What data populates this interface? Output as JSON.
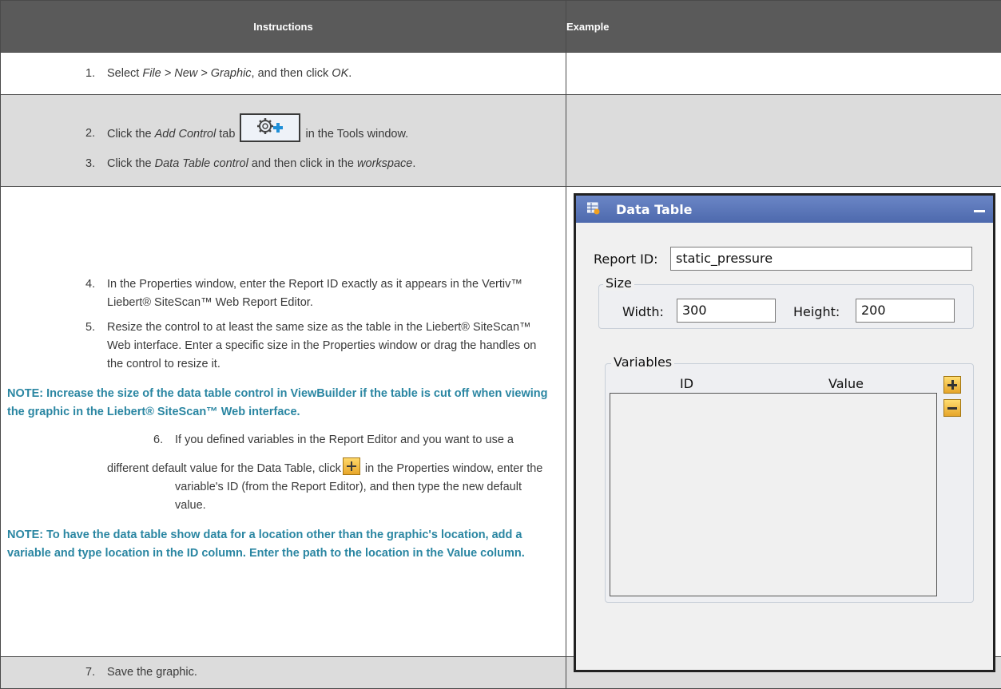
{
  "header": {
    "instructions": "Instructions",
    "example": "Example"
  },
  "row1": {
    "num": "1.",
    "pre": "Select ",
    "path": "File > New > Graphic",
    "mid": ", and then click ",
    "ok": "OK",
    "post": "."
  },
  "row2": {
    "step2_num": "2.",
    "step2_pre": "Click the ",
    "step2_tab": "Add Control",
    "step2_mid": " tab",
    "step2_post": " in the Tools window.",
    "step3_num": "3.",
    "step3_pre": "Click the ",
    "step3_control": "Data Table control",
    "step3_mid": " and then click in the ",
    "step3_ws": "workspace",
    "step3_post": "."
  },
  "row3": {
    "step4_num": "4.",
    "step4_text": "In the Properties window, enter the Report ID exactly as it appears in the Vertiv™ Liebert® SiteScan™ Web Report Editor.",
    "step5_num": "5.",
    "step5_text": "Resize the control to at least the same size as the table in the Liebert® SiteScan™ Web interface. Enter a specific size in the Properties window or drag the handles on the control to resize it.",
    "note1": "NOTE: Increase the size of the data table control in ViewBuilder if the table is cut off when viewing the graphic in the Liebert® SiteScan™ Web interface.",
    "step6_num": "6.",
    "step6_a": "If you defined variables in the Report Editor and you want to use a",
    "step6_b": "different default value for the Data Table, click",
    "step6_c": " in the Properties window, enter the variable's ID (from the Report Editor), and then type the new default value.",
    "note2": "NOTE: To have the data table show data for a location other than the graphic's location, add a variable and type location in the ID column. Enter the path to the location in the Value column."
  },
  "row4": {
    "num": "7.",
    "text": "Save the graphic."
  },
  "panel": {
    "title": "Data Table",
    "report_id_label": "Report ID:",
    "report_id_value": "static_pressure",
    "size_legend": "Size",
    "width_label": "Width:",
    "width_value": "300",
    "height_label": "Height:",
    "height_value": "200",
    "variables_legend": "Variables",
    "col_id": "ID",
    "col_value": "Value"
  }
}
